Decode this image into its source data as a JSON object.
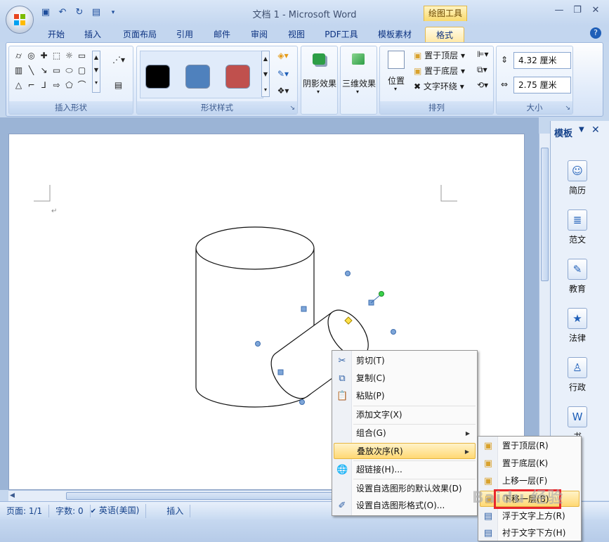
{
  "window": {
    "title": "文档 1 - Microsoft Word",
    "context_tab_group": "绘图工具"
  },
  "qat": {
    "save_icon": "save-icon",
    "undo_icon": "undo-icon",
    "redo_icon": "redo-icon",
    "customize_icon": "qat-customize-icon"
  },
  "tabs": [
    {
      "label": "开始"
    },
    {
      "label": "插入"
    },
    {
      "label": "页面布局"
    },
    {
      "label": "引用"
    },
    {
      "label": "邮件"
    },
    {
      "label": "审阅"
    },
    {
      "label": "视图"
    },
    {
      "label": "PDF工具"
    },
    {
      "label": "模板素材"
    },
    {
      "label": "格式",
      "active": true
    }
  ],
  "ribbon": {
    "insert_shapes": {
      "label": "插入形状"
    },
    "shape_styles": {
      "label": "形状样式",
      "swatches": [
        "#000000",
        "#4f81bd",
        "#c0504d"
      ]
    },
    "shadow": {
      "label": "阴影效果"
    },
    "threed": {
      "label": "三维效果"
    },
    "arrange": {
      "label": "排列",
      "position": "位置",
      "bring_front": "置于顶层",
      "send_back": "置于底层",
      "text_wrap": "文字环绕"
    },
    "size": {
      "label": "大小",
      "height": "4.32 厘米",
      "width": "2.75 厘米"
    }
  },
  "taskpane": {
    "title": "模板",
    "items": [
      {
        "label": "简历"
      },
      {
        "label": "范文"
      },
      {
        "label": "教育"
      },
      {
        "label": "法律"
      },
      {
        "label": "行政"
      },
      {
        "label": "书"
      }
    ]
  },
  "statusbar": {
    "page": "页面: 1/1",
    "words": "字数: 0",
    "language": "英语(美国)",
    "mode": "插入"
  },
  "context_menu": {
    "items": [
      {
        "label": "剪切(T)",
        "icon": "cut-icon"
      },
      {
        "label": "复制(C)",
        "icon": "copy-icon"
      },
      {
        "label": "粘贴(P)",
        "icon": "paste-icon"
      },
      {
        "label": "添加文字(X)"
      },
      {
        "label": "组合(G)",
        "submenu": true
      },
      {
        "label": "叠放次序(R)",
        "submenu": true,
        "highlighted": true
      },
      {
        "label": "超链接(H)...",
        "icon": "hyperlink-icon"
      },
      {
        "label": "设置自选图形的默认效果(D)"
      },
      {
        "label": "设置自选图形格式(O)...",
        "icon": "format-shape-icon"
      }
    ]
  },
  "submenu": {
    "items": [
      {
        "label": "置于顶层(R)"
      },
      {
        "label": "置于底层(K)"
      },
      {
        "label": "上移一层(F)"
      },
      {
        "label": "下移一层(B)",
        "highlighted": true
      },
      {
        "label": "浮于文字上方(R)"
      },
      {
        "label": "衬于文字下方(H)"
      }
    ]
  },
  "watermark": "Baidu 经验"
}
